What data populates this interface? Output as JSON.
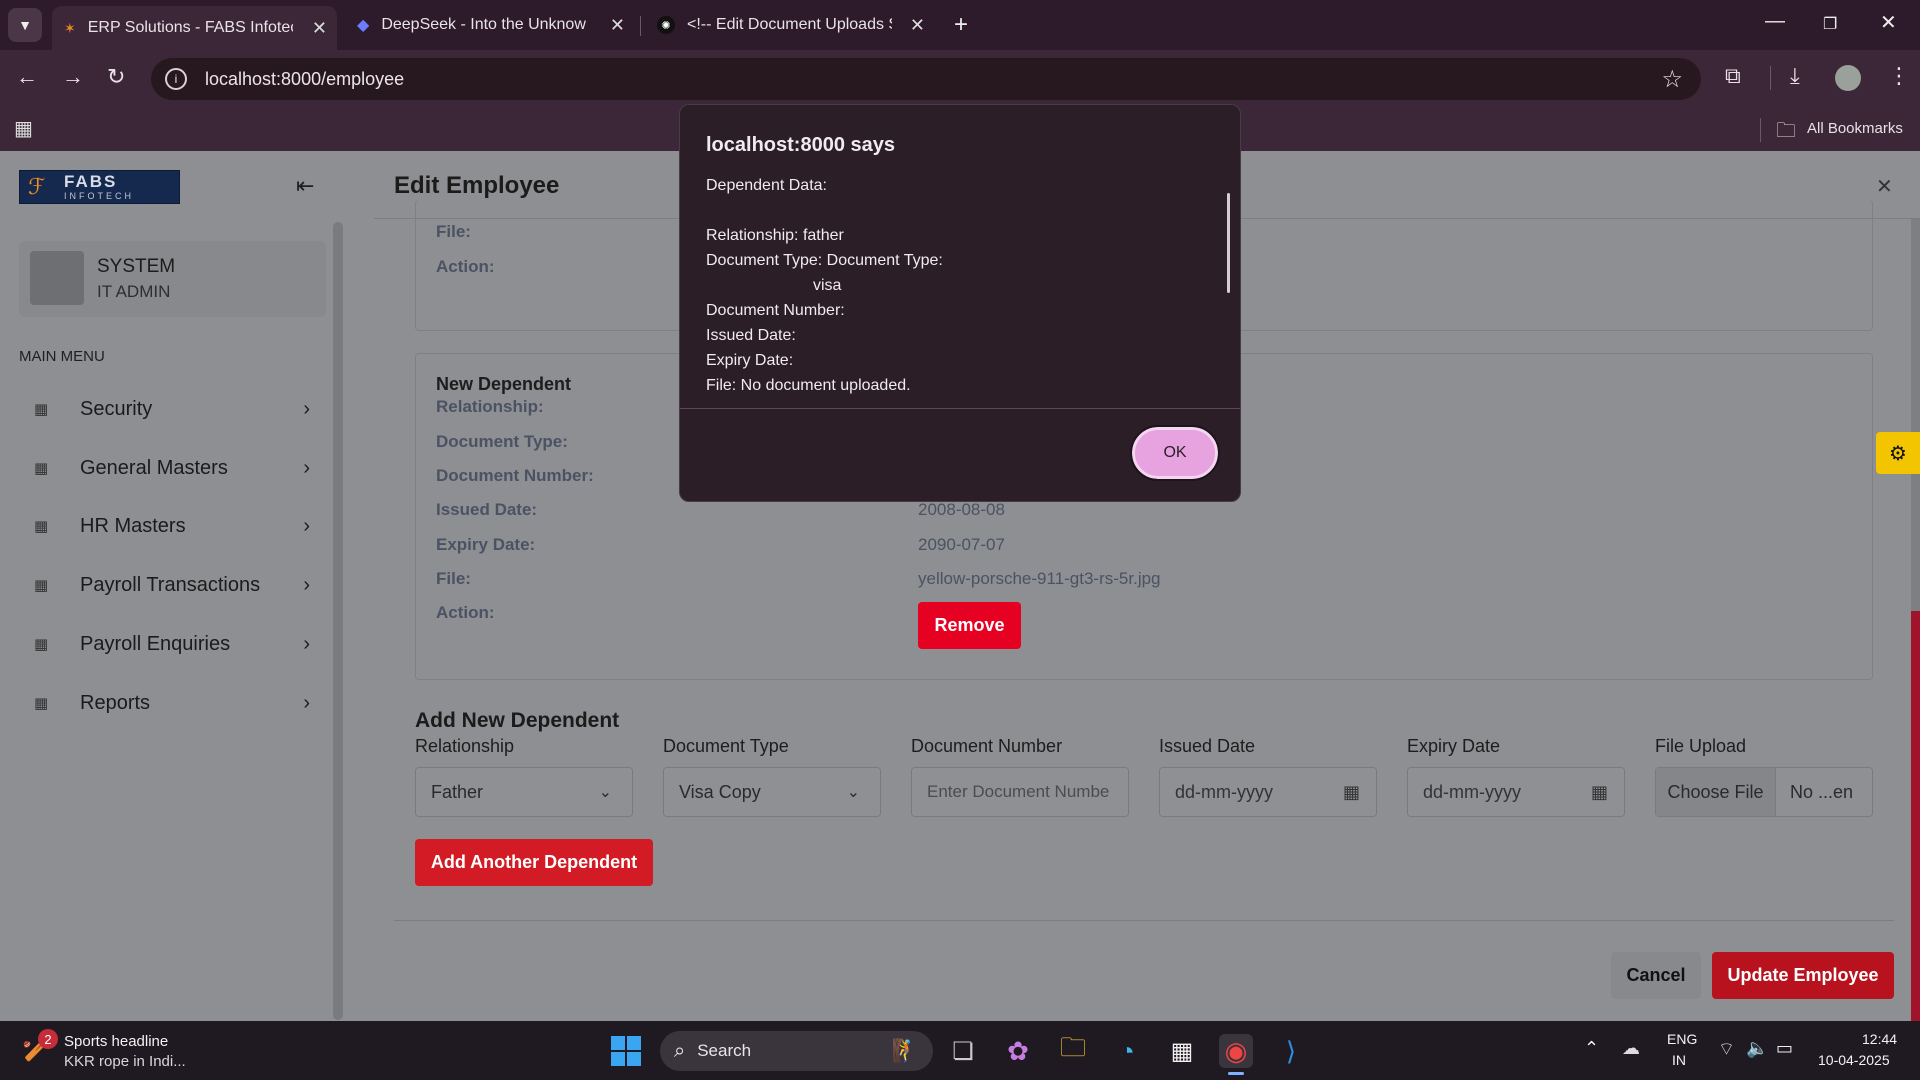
{
  "browser": {
    "tabs": [
      {
        "label": "ERP Solutions - FABS Infotech ,",
        "active": true
      },
      {
        "label": "DeepSeek - Into the Unknown",
        "active": false
      },
      {
        "label": "<!-- Edit Document Uploads Se",
        "active": false
      }
    ],
    "url": "localhost:8000/employee",
    "bookmarks_label": "All Bookmarks"
  },
  "sidebar": {
    "logo_text": "FABS",
    "logo_sub": "INFOTECH",
    "user_name": "SYSTEM",
    "user_role": "IT ADMIN",
    "menu_header": "MAIN MENU",
    "items": [
      {
        "label": "Security"
      },
      {
        "label": "General Masters"
      },
      {
        "label": "HR Masters"
      },
      {
        "label": "Payroll Transactions"
      },
      {
        "label": "Payroll Enquiries"
      },
      {
        "label": "Reports"
      }
    ]
  },
  "modal": {
    "title": "Edit Employee",
    "card1": {
      "file_label": "File:",
      "action_label": "Action:"
    },
    "card2": {
      "heading": "New Dependent",
      "relationship_label": "Relationship:",
      "doc_type_label": "Document Type:",
      "doc_number_label": "Document Number:",
      "issued_label": "Issued Date:",
      "issued_value": "2008-08-08",
      "expiry_label": "Expiry Date:",
      "expiry_value": "2090-07-07",
      "file_label": "File:",
      "file_value": "yellow-porsche-911-gt3-rs-5r.jpg",
      "action_label": "Action:",
      "remove_label": "Remove"
    },
    "add_section": {
      "heading": "Add New Dependent",
      "relationship_label": "Relationship",
      "relationship_value": "Father",
      "doc_type_label": "Document Type",
      "doc_type_value": "Visa Copy",
      "doc_number_label": "Document Number",
      "doc_number_placeholder": "Enter Document Numbe",
      "issued_label": "Issued Date",
      "issued_placeholder": "dd-mm-yyyy",
      "expiry_label": "Expiry Date",
      "expiry_placeholder": "dd-mm-yyyy",
      "file_label": "File Upload",
      "choose_file": "Choose File",
      "no_file": "No ...en",
      "add_another": "Add Another Dependent"
    },
    "cancel_label": "Cancel",
    "update_label": "Update Employee"
  },
  "dialog": {
    "title": "localhost:8000 says",
    "lines": [
      "Dependent Data:",
      "",
      "Relationship: father",
      "Document Type: Document Type:",
      "visa",
      "Document Number:",
      "Issued Date:",
      "Expiry Date:",
      "File: No document uploaded."
    ],
    "ok_label": "OK"
  },
  "taskbar": {
    "news_badge": "2",
    "news_title": "Sports headline",
    "news_sub": "KKR rope in Indi...",
    "search_label": "Search",
    "lang_top": "ENG",
    "lang_bottom": "IN",
    "time": "12:44",
    "date": "10-04-2025"
  },
  "colors": {
    "accent_red": "#e60021",
    "update_red": "#b8121f",
    "dialog_button": "#e6a3e0",
    "settings_tab": "#f2c500"
  }
}
